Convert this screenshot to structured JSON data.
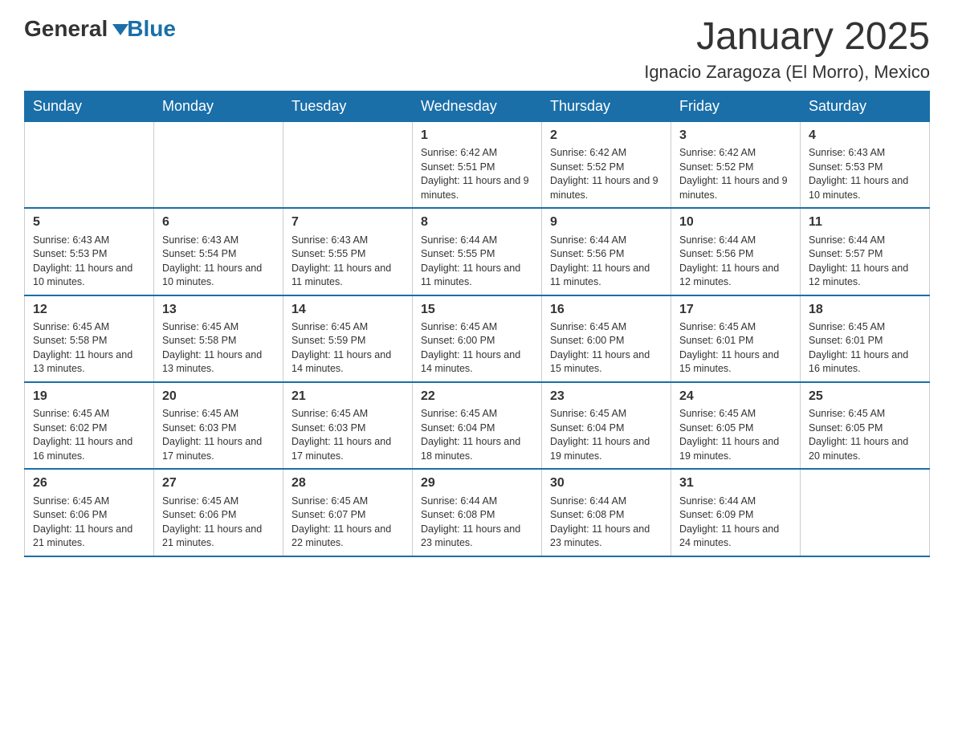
{
  "logo": {
    "text_general": "General",
    "text_blue": "Blue"
  },
  "title": "January 2025",
  "subtitle": "Ignacio Zaragoza (El Morro), Mexico",
  "days_of_week": [
    "Sunday",
    "Monday",
    "Tuesday",
    "Wednesday",
    "Thursday",
    "Friday",
    "Saturday"
  ],
  "weeks": [
    [
      {
        "day": "",
        "info": ""
      },
      {
        "day": "",
        "info": ""
      },
      {
        "day": "",
        "info": ""
      },
      {
        "day": "1",
        "info": "Sunrise: 6:42 AM\nSunset: 5:51 PM\nDaylight: 11 hours and 9 minutes."
      },
      {
        "day": "2",
        "info": "Sunrise: 6:42 AM\nSunset: 5:52 PM\nDaylight: 11 hours and 9 minutes."
      },
      {
        "day": "3",
        "info": "Sunrise: 6:42 AM\nSunset: 5:52 PM\nDaylight: 11 hours and 9 minutes."
      },
      {
        "day": "4",
        "info": "Sunrise: 6:43 AM\nSunset: 5:53 PM\nDaylight: 11 hours and 10 minutes."
      }
    ],
    [
      {
        "day": "5",
        "info": "Sunrise: 6:43 AM\nSunset: 5:53 PM\nDaylight: 11 hours and 10 minutes."
      },
      {
        "day": "6",
        "info": "Sunrise: 6:43 AM\nSunset: 5:54 PM\nDaylight: 11 hours and 10 minutes."
      },
      {
        "day": "7",
        "info": "Sunrise: 6:43 AM\nSunset: 5:55 PM\nDaylight: 11 hours and 11 minutes."
      },
      {
        "day": "8",
        "info": "Sunrise: 6:44 AM\nSunset: 5:55 PM\nDaylight: 11 hours and 11 minutes."
      },
      {
        "day": "9",
        "info": "Sunrise: 6:44 AM\nSunset: 5:56 PM\nDaylight: 11 hours and 11 minutes."
      },
      {
        "day": "10",
        "info": "Sunrise: 6:44 AM\nSunset: 5:56 PM\nDaylight: 11 hours and 12 minutes."
      },
      {
        "day": "11",
        "info": "Sunrise: 6:44 AM\nSunset: 5:57 PM\nDaylight: 11 hours and 12 minutes."
      }
    ],
    [
      {
        "day": "12",
        "info": "Sunrise: 6:45 AM\nSunset: 5:58 PM\nDaylight: 11 hours and 13 minutes."
      },
      {
        "day": "13",
        "info": "Sunrise: 6:45 AM\nSunset: 5:58 PM\nDaylight: 11 hours and 13 minutes."
      },
      {
        "day": "14",
        "info": "Sunrise: 6:45 AM\nSunset: 5:59 PM\nDaylight: 11 hours and 14 minutes."
      },
      {
        "day": "15",
        "info": "Sunrise: 6:45 AM\nSunset: 6:00 PM\nDaylight: 11 hours and 14 minutes."
      },
      {
        "day": "16",
        "info": "Sunrise: 6:45 AM\nSunset: 6:00 PM\nDaylight: 11 hours and 15 minutes."
      },
      {
        "day": "17",
        "info": "Sunrise: 6:45 AM\nSunset: 6:01 PM\nDaylight: 11 hours and 15 minutes."
      },
      {
        "day": "18",
        "info": "Sunrise: 6:45 AM\nSunset: 6:01 PM\nDaylight: 11 hours and 16 minutes."
      }
    ],
    [
      {
        "day": "19",
        "info": "Sunrise: 6:45 AM\nSunset: 6:02 PM\nDaylight: 11 hours and 16 minutes."
      },
      {
        "day": "20",
        "info": "Sunrise: 6:45 AM\nSunset: 6:03 PM\nDaylight: 11 hours and 17 minutes."
      },
      {
        "day": "21",
        "info": "Sunrise: 6:45 AM\nSunset: 6:03 PM\nDaylight: 11 hours and 17 minutes."
      },
      {
        "day": "22",
        "info": "Sunrise: 6:45 AM\nSunset: 6:04 PM\nDaylight: 11 hours and 18 minutes."
      },
      {
        "day": "23",
        "info": "Sunrise: 6:45 AM\nSunset: 6:04 PM\nDaylight: 11 hours and 19 minutes."
      },
      {
        "day": "24",
        "info": "Sunrise: 6:45 AM\nSunset: 6:05 PM\nDaylight: 11 hours and 19 minutes."
      },
      {
        "day": "25",
        "info": "Sunrise: 6:45 AM\nSunset: 6:05 PM\nDaylight: 11 hours and 20 minutes."
      }
    ],
    [
      {
        "day": "26",
        "info": "Sunrise: 6:45 AM\nSunset: 6:06 PM\nDaylight: 11 hours and 21 minutes."
      },
      {
        "day": "27",
        "info": "Sunrise: 6:45 AM\nSunset: 6:06 PM\nDaylight: 11 hours and 21 minutes."
      },
      {
        "day": "28",
        "info": "Sunrise: 6:45 AM\nSunset: 6:07 PM\nDaylight: 11 hours and 22 minutes."
      },
      {
        "day": "29",
        "info": "Sunrise: 6:44 AM\nSunset: 6:08 PM\nDaylight: 11 hours and 23 minutes."
      },
      {
        "day": "30",
        "info": "Sunrise: 6:44 AM\nSunset: 6:08 PM\nDaylight: 11 hours and 23 minutes."
      },
      {
        "day": "31",
        "info": "Sunrise: 6:44 AM\nSunset: 6:09 PM\nDaylight: 11 hours and 24 minutes."
      },
      {
        "day": "",
        "info": ""
      }
    ]
  ]
}
